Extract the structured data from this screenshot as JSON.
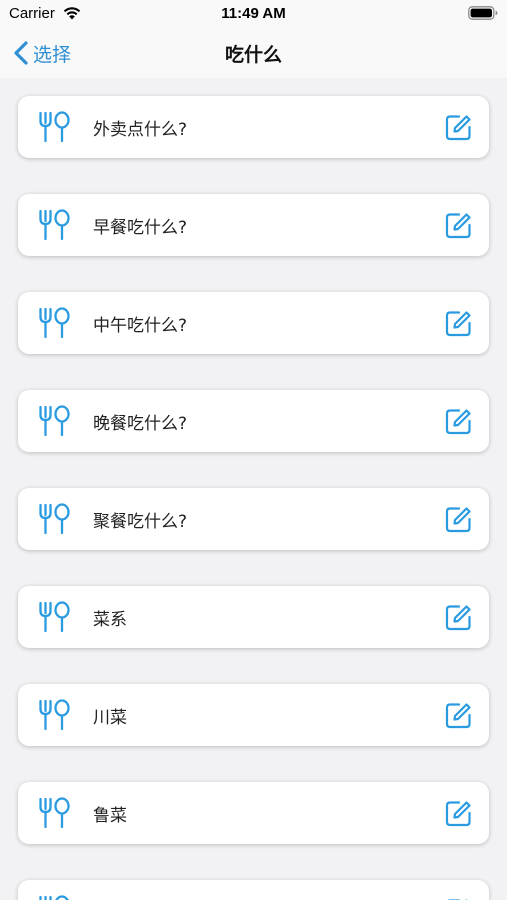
{
  "status_bar": {
    "carrier": "Carrier",
    "time": "11:49 AM",
    "wifi_icon": "wifi-icon",
    "battery_icon": "battery-icon"
  },
  "nav_bar": {
    "back_label": "选择",
    "title": "吃什么",
    "back_icon": "chevron-left-icon"
  },
  "colors": {
    "accent": "#2f8fd3",
    "icon_blue": "#2a9be0",
    "background": "#f2f2f4",
    "card": "#ffffff"
  },
  "list": {
    "item_icon": "fork-spoon-icon",
    "edit_icon": "edit-icon",
    "items": [
      {
        "label": "外卖点什么?"
      },
      {
        "label": "早餐吃什么?"
      },
      {
        "label": "中午吃什么?"
      },
      {
        "label": "晚餐吃什么?"
      },
      {
        "label": "聚餐吃什么?"
      },
      {
        "label": "菜系"
      },
      {
        "label": "川菜"
      },
      {
        "label": "鲁菜"
      },
      {
        "label": ""
      }
    ]
  }
}
